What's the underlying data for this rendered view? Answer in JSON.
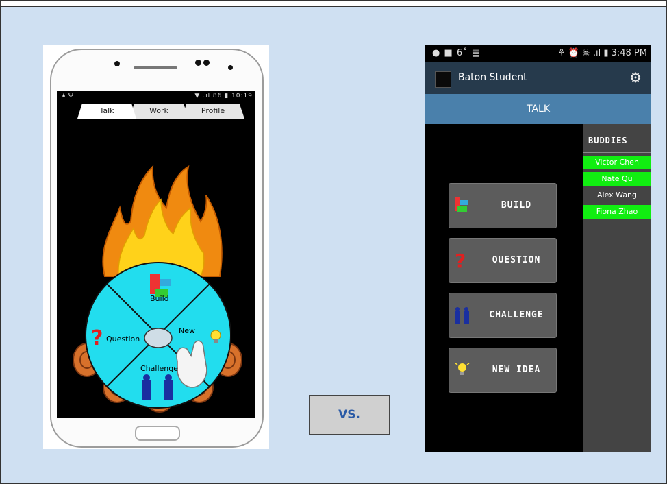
{
  "left_phone": {
    "status": {
      "left_icons": "★ Ψ",
      "right_text": "▼ .ıl 86 ▮ 10:19"
    },
    "tabs": [
      "Talk",
      "Work",
      "Profile"
    ],
    "wheel": {
      "build": "Build",
      "question": "Question",
      "new": "New",
      "challenge": "Challenge"
    }
  },
  "vs_label": "VS.",
  "right_phone": {
    "status": {
      "left": "● ■ 6˚ ▤",
      "right": "⚘ ⏰ ☠ .ıl ▮ 3:48 PM"
    },
    "app_title": "Baton Student",
    "talk_label": "TALK",
    "buddies_title": "BUDDIES",
    "buddies": [
      {
        "name": "Victor Chen",
        "online": true
      },
      {
        "name": "Nate Qu",
        "online": true
      },
      {
        "name": "Alex Wang",
        "online": false
      },
      {
        "name": "Fiona Zhao",
        "online": true
      }
    ],
    "buttons": [
      {
        "label": "BUILD",
        "icon": "build-blocks-icon"
      },
      {
        "label": "QUESTION",
        "icon": "question-mark-icon"
      },
      {
        "label": "CHALLENGE",
        "icon": "podiums-icon"
      },
      {
        "label": "NEW IDEA",
        "icon": "lightbulb-icon"
      }
    ]
  },
  "colors": {
    "background": "#cfe0f2",
    "wheel": "#22ddee",
    "buddy_online": "#11ee11",
    "talk_bar": "#4a80ab",
    "action_bar": "#263a4c"
  }
}
